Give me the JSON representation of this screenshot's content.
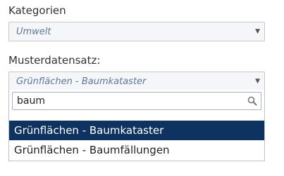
{
  "kategorien": {
    "label": "Kategorien",
    "selected": "Umwelt"
  },
  "musterdatensatz": {
    "label": "Musterdatensatz:",
    "selected": "Grünflächen - Baumkataster",
    "search_value": "baum",
    "options": [
      {
        "label": "Grünflächen - Baumkataster",
        "highlighted": true
      },
      {
        "label": "Grünflächen - Baumfällungen",
        "highlighted": false
      }
    ]
  },
  "icons": {
    "caret": "chevron-down-icon",
    "search": "search-icon"
  },
  "colors": {
    "highlight": "#0e3360",
    "placeholder_text": "#607896"
  }
}
